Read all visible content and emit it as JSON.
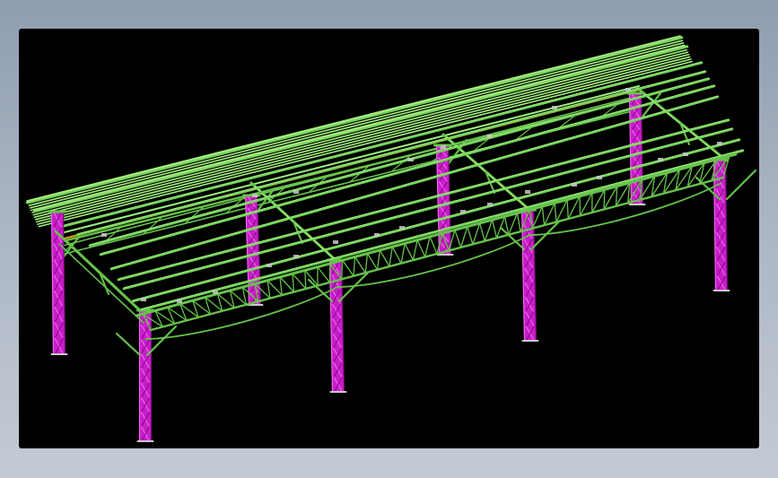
{
  "viewport": {
    "background": "#000000",
    "model": "steel-frame-canopy-structure"
  },
  "colors": {
    "column": "#c81dc8",
    "column_highlight": "#f064f0",
    "beam": "#66c24a",
    "beam_highlight": "#a8ee80",
    "purlin": "#6fd25a",
    "roof_sheet": "#9df07f",
    "eave_strip": "#d79a1a",
    "connector": "#c9c9c9"
  }
}
